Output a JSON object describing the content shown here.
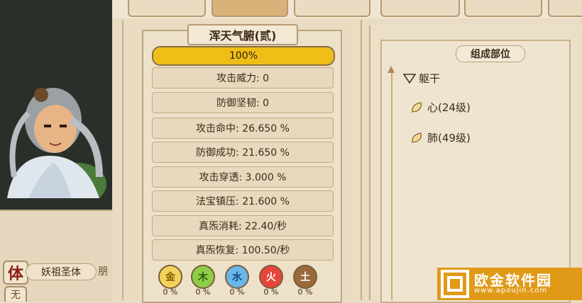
{
  "character": {
    "body_tag": "体",
    "body_name": "妖祖圣体",
    "body_next": "朋",
    "lower_tag": "无"
  },
  "organ_panel": {
    "title": "浑天气腑(贰)",
    "progress_value": 1.0,
    "progress_text": "100%",
    "stats": [
      "攻击威力: 0",
      "防御坚韧: 0",
      "攻击命中: 26.650 %",
      "防御成功: 21.650 %",
      "攻击穿透: 3.000 %",
      "法宝镇压: 21.600 %",
      "真炁消耗: 22.40/秒",
      "真炁恢复: 100.50/秒"
    ],
    "elements": [
      {
        "name": "金",
        "percent": "0 %",
        "color": "#f2d35a",
        "text_color": "#8a5a00"
      },
      {
        "name": "木",
        "percent": "0 %",
        "color": "#8ccf46",
        "text_color": "#2d5a10"
      },
      {
        "name": "水",
        "percent": "0 %",
        "color": "#67b7ea",
        "text_color": "#144a7a"
      },
      {
        "name": "火",
        "percent": "0 %",
        "color": "#e8453a",
        "text_color": "#ffffff"
      },
      {
        "name": "土",
        "percent": "0 %",
        "color": "#9a6a3a",
        "text_color": "#ffffff"
      }
    ]
  },
  "parts_panel": {
    "title": "组成部位",
    "trunk": "躯干",
    "organs": [
      {
        "label": "心(24级)"
      },
      {
        "label": "肺(49级)"
      }
    ]
  },
  "watermark": {
    "name": "欧金软件园",
    "url": "www.apoujin.com"
  }
}
